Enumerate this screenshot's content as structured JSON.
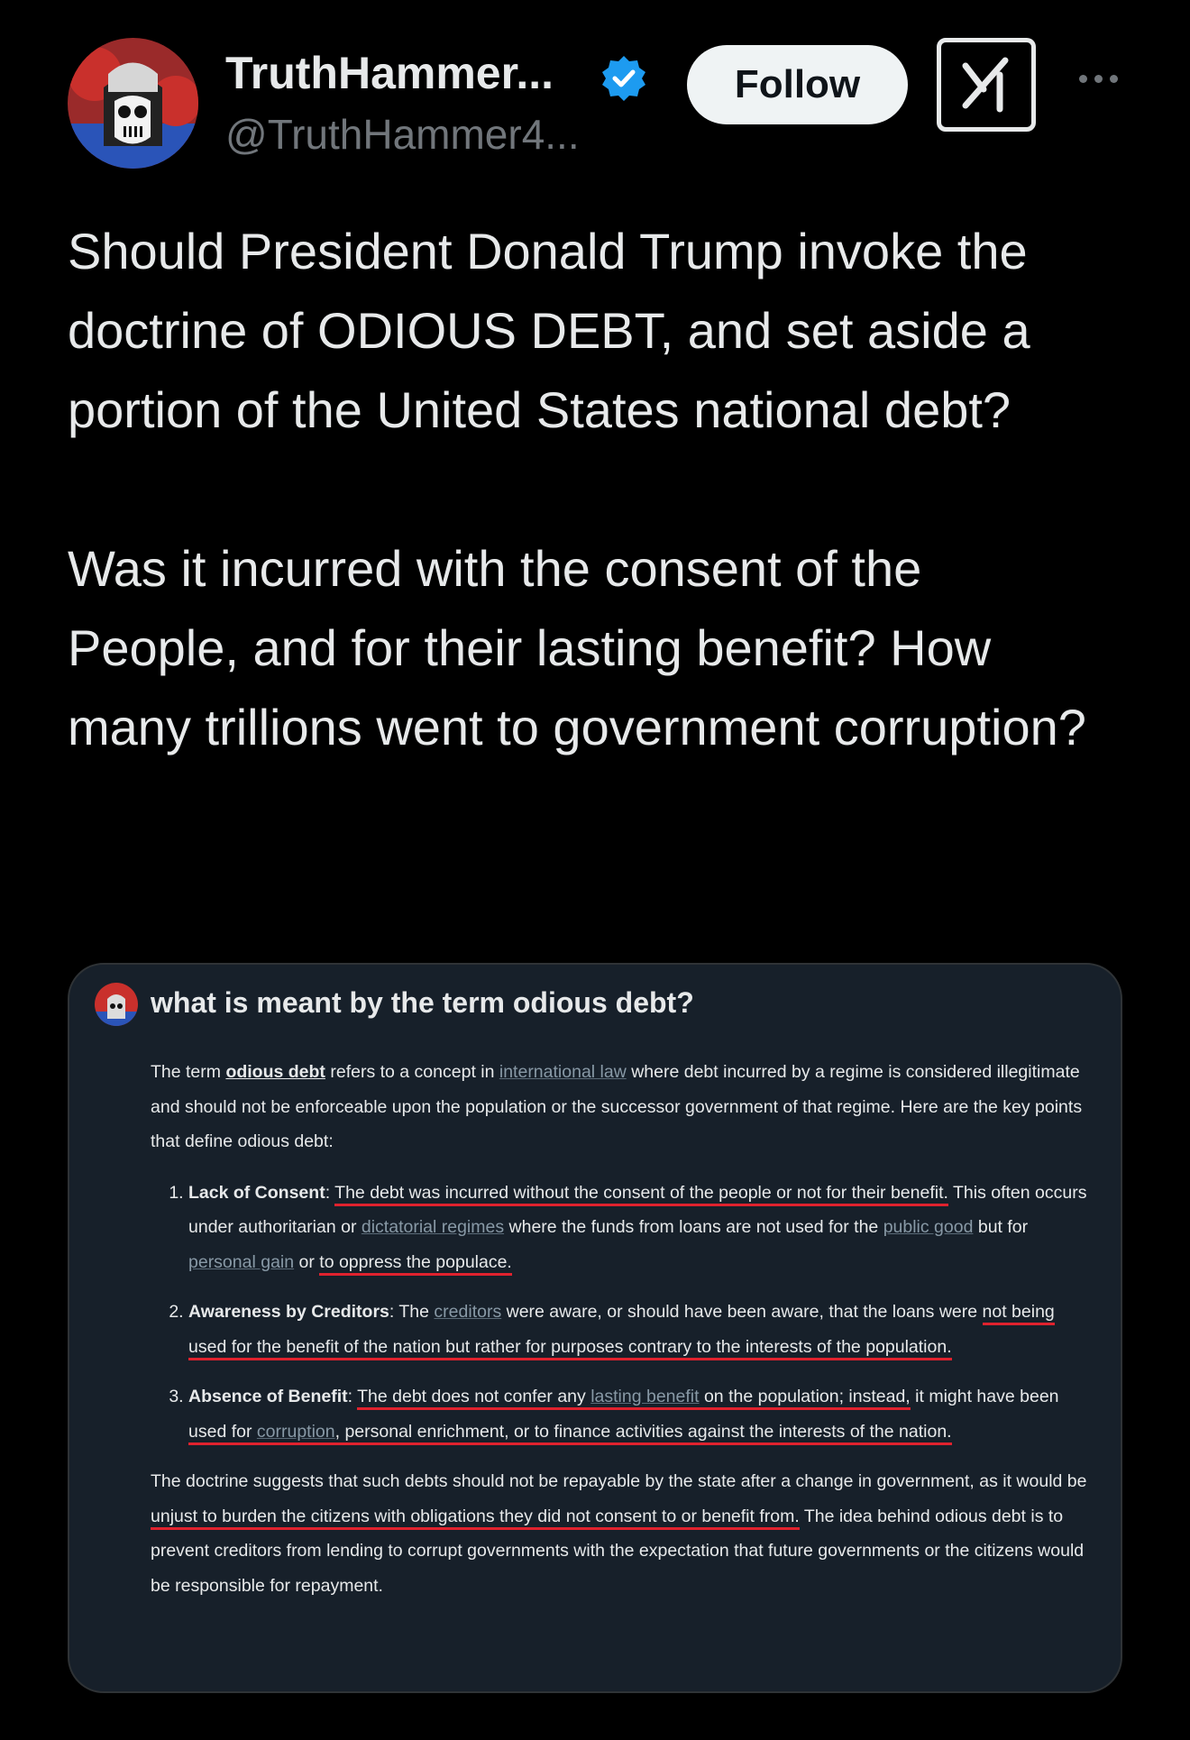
{
  "post": {
    "display_name": "TruthHammer...",
    "handle": "@TruthHammer4...",
    "follow_label": "Follow",
    "paragraphs": [
      "Should President Donald Trump invoke the doctrine of ODIOUS DEBT, and set aside a portion of the United States national debt?",
      "Was it incurred with the consent of the People, and for their lasting benefit? How many trillions went to government corruption?"
    ]
  },
  "embedded": {
    "question": "what is meant by the term odious debt?",
    "intro": {
      "t1": "The term ",
      "term": "odious debt",
      "t2": " refers to a concept in ",
      "link1": "international law",
      "t3": " where debt incurred by a regime is considered illegitimate and should not be enforceable upon the population or the successor government of that regime. Here are the key points that define odious debt:"
    },
    "points": [
      {
        "title": "Lack of Consent",
        "colon": ": ",
        "p1": "The debt was incurred without the consent of the people or not for their benefit.",
        "p2": " This often occurs under authoritarian or ",
        "link1": "dictatorial regimes",
        "p3": " where the funds from loans are not used for the ",
        "link2": "public good",
        "p4": " but for ",
        "link3": "personal gain",
        "p5": " or ",
        "p6": "to oppress the populace."
      },
      {
        "title": "Awareness by Creditors",
        "colon": ": ",
        "p1": "The ",
        "link1": "creditors",
        "p2": " were aware, or should have been aware, that the loans were ",
        "p3": "not being used for the benefit of the nation but rather for purposes contrary to the interests of the population."
      },
      {
        "title": "Absence of Benefit",
        "colon": ": ",
        "p1": "The debt does not confer any ",
        "link1": "lasting benefit",
        "p2": " on the population; instead,",
        "p3": " it might have been ",
        "p4": "used for ",
        "link2": "corruption",
        "p5": ", personal enrichment, or to finance activities against the interests of the nation."
      }
    ],
    "conclusion": {
      "c1": "The doctrine suggests that such debts should not be repayable by the state after a change in government, as it would be ",
      "c2": "unjust to burden the citizens with obligations they did not consent to or benefit from.",
      "c3": " The idea behind odious debt is to prevent creditors from lending to corrupt governments with the expectation that future governments or the citizens would be responsible for repayment."
    }
  },
  "icons": {
    "verified": "verified-badge-icon",
    "grok": "grok-icon",
    "more": "more-options-icon"
  },
  "colors": {
    "background": "#000000",
    "text": "#e7e9ea",
    "secondary": "#71767b",
    "verified": "#1d9bf0",
    "card": "#17202a",
    "highlight": "#e0222e"
  }
}
